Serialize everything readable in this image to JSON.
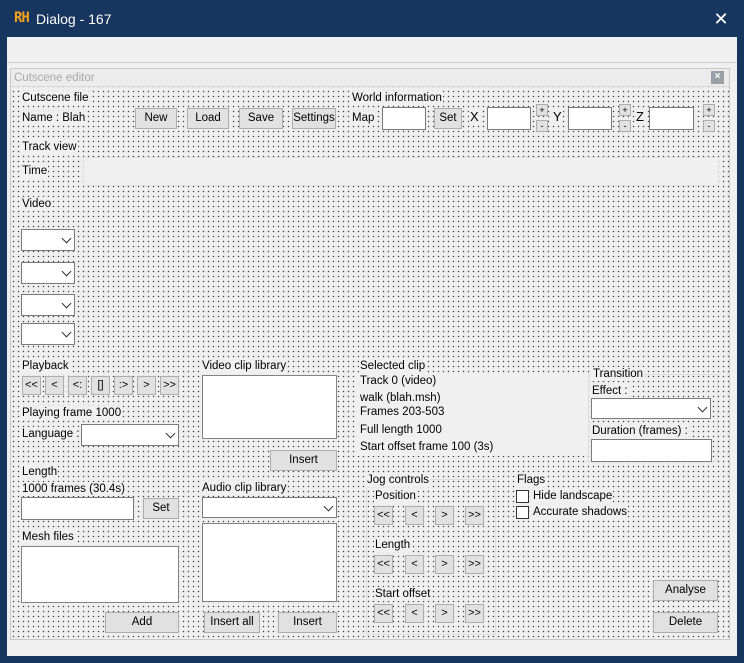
{
  "window": {
    "logo": "RH",
    "title": "Dialog - 167"
  },
  "editor": {
    "title": "Cutscene editor"
  },
  "cutscene_file": {
    "group_label": "Cutscene file",
    "name_text": "Name : Blah",
    "new_label": "New",
    "load_label": "Load",
    "save_label": "Save",
    "settings_label": "Settings"
  },
  "world_info": {
    "group_label": "World information",
    "map_label": "Map",
    "set_label": "Set",
    "x_label": "X",
    "y_label": "Y",
    "z_label": "Z",
    "plus": "+",
    "minus": "-"
  },
  "track_view": {
    "group_label": "Track view",
    "time_label": "Time",
    "video_label": "Video"
  },
  "playback": {
    "group_label": "Playback",
    "buttons": [
      "<<",
      "<",
      "<:",
      "[]",
      ":>",
      ">",
      ">>"
    ],
    "playing_frame": "Playing frame 1000",
    "language_label": "Language :"
  },
  "length": {
    "group_label": "Length",
    "value_text": "1000 frames (30.4s)",
    "set_label": "Set"
  },
  "mesh_files": {
    "group_label": "Mesh files",
    "add_label": "Add"
  },
  "video_library": {
    "group_label": "Video clip library",
    "insert_label": "Insert"
  },
  "audio_library": {
    "group_label": "Audio clip library",
    "insert_all_label": "Insert all",
    "insert_label": "Insert"
  },
  "selected_clip": {
    "group_label": "Selected clip",
    "lines": [
      "Track 0 (video)",
      "walk (blah.msh)",
      "Frames 203-503",
      "Full length 1000",
      "Start offset frame 100 (3s)"
    ]
  },
  "transition": {
    "group_label": "Transition",
    "effect_label": "Effect :",
    "duration_label": "Duration (frames) :"
  },
  "jog_controls": {
    "group_label": "Jog controls",
    "position_label": "Position",
    "length_label": "Length",
    "start_offset_label": "Start offset",
    "buttons": [
      "<<",
      "<",
      ">",
      ">>"
    ]
  },
  "flags": {
    "group_label": "Flags",
    "items": [
      {
        "label": "Hide landscape",
        "checked": false
      },
      {
        "label": "Accurate shadows",
        "checked": false
      }
    ]
  },
  "actions": {
    "analyse_label": "Analyse",
    "delete_label": "Delete"
  }
}
